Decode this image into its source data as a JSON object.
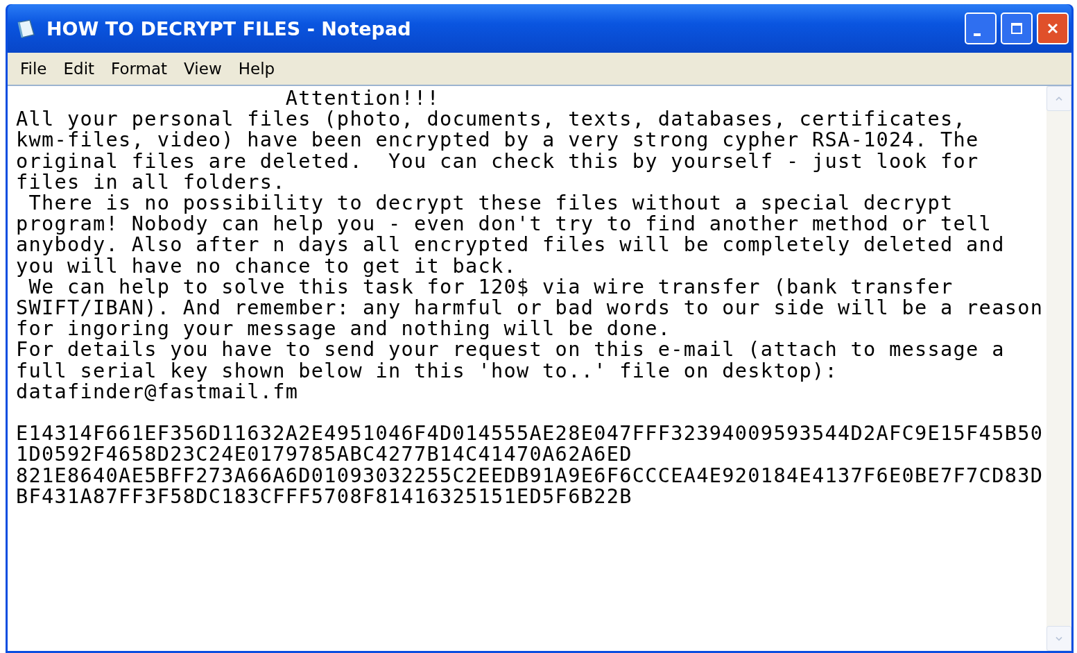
{
  "window": {
    "title": "HOW TO DECRYPT FILES - Notepad"
  },
  "menu": [
    "File",
    "Edit",
    "Format",
    "View",
    "Help"
  ],
  "document": {
    "blocks": [
      {
        "lines": [
          "                     Attention!!!",
          "All your personal files (photo, documents, texts, databases, certificates,",
          "kwm-files, video) have been encrypted by a very strong cypher RSA-1024. The",
          "original files are deleted.  You can check this by yourself - just look for",
          "files in all folders.",
          " There is no possibility to decrypt these files without a special decrypt",
          "program! Nobody can help you - even don't try to find another method or tell",
          "anybody. Also after n days all encrypted files will be completely deleted and",
          "you will have no chance to get it back.",
          " We can help to solve this task for 120$ via wire transfer (bank transfer",
          "SWIFT/IBAN). And remember: any harmful or bad words to our side will be a reason",
          "for ingoring your message and nothing will be done.",
          "For details you have to send your request on this e-mail (attach to message a",
          "full serial key shown below in this 'how to..' file on desktop):",
          "datafinder@fastmail.fm"
        ]
      },
      {
        "lines": [
          "E14314F661EF356D11632A2E4951046F4D014555AE28E047FFF32394009593544D2AFC9E15F45B50",
          "1D0592F4658D23C24E0179785ABC4277B14C41470A62A6ED",
          "821E8640AE5BFF273A66A6D01093032255C2EEDB91A9E6F6CCCEA4E920184E4137F6E0BE7F7CD83D",
          "BF431A87FF3F58DC183CFFF5708F81416325151ED5F6B22B"
        ]
      }
    ]
  }
}
